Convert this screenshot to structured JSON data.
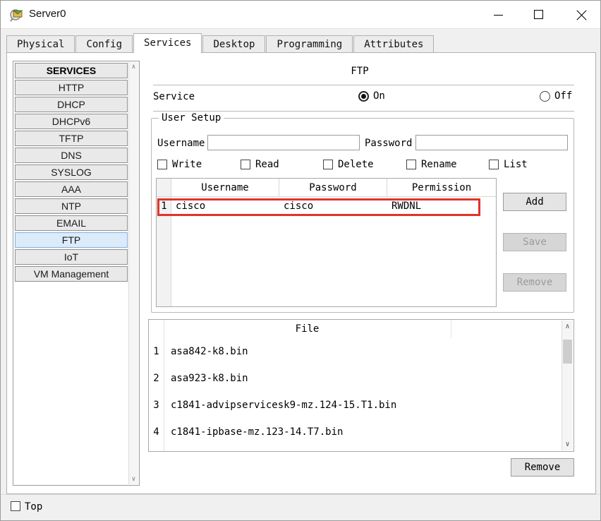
{
  "window": {
    "title": "Server0",
    "controls": {
      "minimize": "minimize",
      "maximize": "maximize",
      "close": "close"
    }
  },
  "tabs": [
    {
      "label": "Physical",
      "active": false
    },
    {
      "label": "Config",
      "active": false
    },
    {
      "label": "Services",
      "active": true
    },
    {
      "label": "Desktop",
      "active": false
    },
    {
      "label": "Programming",
      "active": false
    },
    {
      "label": "Attributes",
      "active": false
    }
  ],
  "sidebar": {
    "header": "SERVICES",
    "items": [
      {
        "label": "HTTP"
      },
      {
        "label": "DHCP"
      },
      {
        "label": "DHCPv6"
      },
      {
        "label": "TFTP"
      },
      {
        "label": "DNS"
      },
      {
        "label": "SYSLOG"
      },
      {
        "label": "AAA"
      },
      {
        "label": "NTP"
      },
      {
        "label": "EMAIL"
      },
      {
        "label": "FTP"
      },
      {
        "label": "IoT"
      },
      {
        "label": "VM Management"
      }
    ],
    "selected": "FTP"
  },
  "ftp": {
    "title": "FTP",
    "service_label": "Service",
    "on_label": "On",
    "off_label": "Off",
    "service_state": "on",
    "user_setup": {
      "legend": "User Setup",
      "username_label": "Username",
      "username_value": "",
      "password_label": "Password",
      "password_value": "",
      "permissions": [
        "Write",
        "Read",
        "Delete",
        "Rename",
        "List"
      ],
      "permissions_checked": [
        false,
        false,
        false,
        false,
        false
      ],
      "table": {
        "headers": [
          "Username",
          "Password",
          "Permission"
        ],
        "rows": [
          {
            "num": "1",
            "username": "cisco",
            "password": "cisco",
            "permission": "RWDNL",
            "highlighted": true
          }
        ]
      },
      "buttons": {
        "add": "Add",
        "save": "Save",
        "remove": "Remove",
        "save_enabled": false,
        "remove_enabled": false
      }
    },
    "file_table": {
      "header": "File",
      "rows": [
        {
          "num": "1",
          "file": "asa842-k8.bin"
        },
        {
          "num": "2",
          "file": "asa923-k8.bin"
        },
        {
          "num": "3",
          "file": "c1841-advipservicesk9-mz.124-15.T1.bin"
        },
        {
          "num": "4",
          "file": "c1841-ipbase-mz.123-14.T7.bin"
        }
      ],
      "remove_button": "Remove"
    }
  },
  "footer": {
    "top_label": "Top",
    "top_checked": false
  },
  "icons": {
    "scroll_up": "∧",
    "scroll_down": "∨"
  },
  "colors": {
    "highlight_red": "#e0342b",
    "selected_item_bg": "#dcebfa",
    "selected_item_border": "#7fb2e0"
  }
}
